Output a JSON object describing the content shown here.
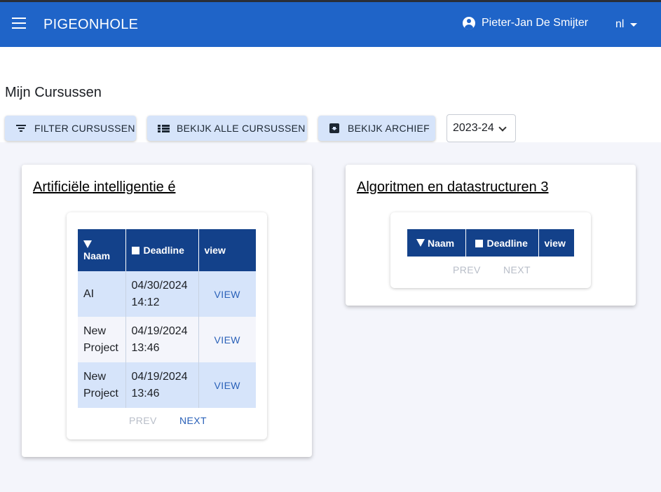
{
  "appbar": {
    "brand": "PIGEONHOLE",
    "user_name": "Pieter-Jan De Smijter",
    "language": "nl"
  },
  "page": {
    "title": "Mijn Cursussen"
  },
  "toolbar": {
    "filter_label": "FILTER CURSUSSEN",
    "all_label": "BEKIJK ALLE CURSUSSEN",
    "archive_label": "BEKIJK ARCHIEF",
    "year": "2023-24"
  },
  "courses": [
    {
      "title": "Artificiële intelligentie é",
      "columns": {
        "name": "Naam",
        "deadline": "Deadline",
        "view": "view"
      },
      "rows": [
        {
          "name": "AI",
          "date": "04/30/2024",
          "time": "14:12",
          "view": "VIEW"
        },
        {
          "name_line1": "New",
          "name_line2": "Project",
          "date": "04/19/2024",
          "time": "13:46",
          "view": "VIEW"
        },
        {
          "name_line1": "New",
          "name_line2": "Project",
          "date": "04/19/2024",
          "time": "13:46",
          "view": "VIEW"
        }
      ],
      "prev": "PREV",
      "next": "NEXT",
      "colors": {
        "next": "#2a61b8"
      }
    },
    {
      "title": "Algoritmen en datastructuren 3",
      "columns": {
        "name": "Naam",
        "deadline": "Deadline",
        "view": "view"
      },
      "rows": [],
      "prev": "PREV",
      "next": "NEXT",
      "colors": {
        "next": "#b8bec8"
      }
    }
  ],
  "colors": {
    "appbar": "#1f64c8",
    "button_bg": "#d6e4fa",
    "table_header": "#13418a",
    "row_highlight": "#d6e4fa",
    "link": "#2a61b8"
  },
  "icons": {
    "menu": "hamburger-icon",
    "user": "account-circle-icon",
    "lang": "caret-down-icon",
    "filter": "filter-icon",
    "all": "list-icon",
    "archive": "archive-icon",
    "year": "chevron-down-icon"
  }
}
